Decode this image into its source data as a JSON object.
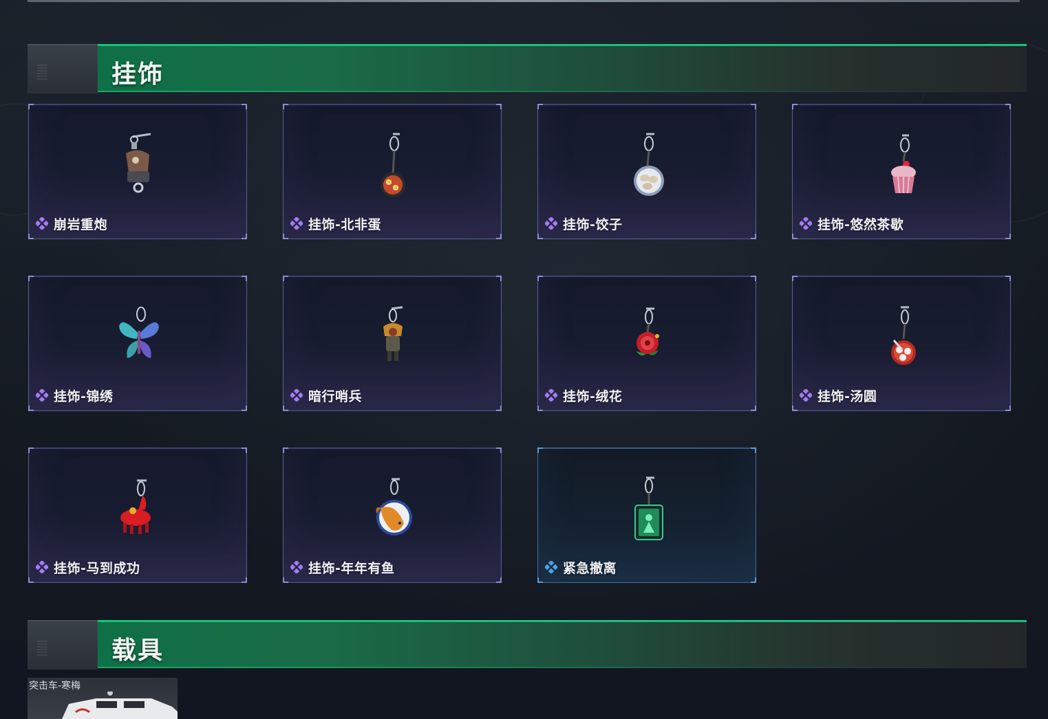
{
  "sections": [
    {
      "title": "挂饰"
    },
    {
      "title": "载具"
    }
  ],
  "charms": [
    {
      "label": "崩岩重炮",
      "rarity": "purple",
      "icon": "cannon-charm-icon"
    },
    {
      "label": "挂饰-北非蛋",
      "rarity": "purple",
      "icon": "shakshuka-pan-charm-icon"
    },
    {
      "label": "挂饰-饺子",
      "rarity": "purple",
      "icon": "dumpling-plate-charm-icon"
    },
    {
      "label": "挂饰-悠然茶歇",
      "rarity": "purple",
      "icon": "cupcake-charm-icon"
    },
    {
      "label": "挂饰-锦绣",
      "rarity": "purple",
      "icon": "butterfly-charm-icon"
    },
    {
      "label": "暗行哨兵",
      "rarity": "purple",
      "icon": "sentinel-figure-charm-icon"
    },
    {
      "label": "挂饰-绒花",
      "rarity": "purple",
      "icon": "velvet-flower-charm-icon"
    },
    {
      "label": "挂饰-汤圆",
      "rarity": "purple",
      "icon": "tangyuan-bowl-charm-icon"
    },
    {
      "label": "挂饰-马到成功",
      "rarity": "purple",
      "icon": "red-horse-charm-icon"
    },
    {
      "label": "挂饰-年年有鱼",
      "rarity": "purple",
      "icon": "fish-plate-charm-icon"
    },
    {
      "label": "紧急撤离",
      "rarity": "blue",
      "icon": "green-tag-charm-icon"
    }
  ],
  "vehicle": {
    "label": "突击车-寒梅",
    "icon": "assault-vehicle-icon"
  },
  "colors": {
    "accent_green": "#19c27a",
    "purple_rarity": "#a27cf0",
    "blue_rarity": "#4aa3e8",
    "card_border_purple": "#5a5f96",
    "card_border_blue": "#3e6f9a"
  }
}
